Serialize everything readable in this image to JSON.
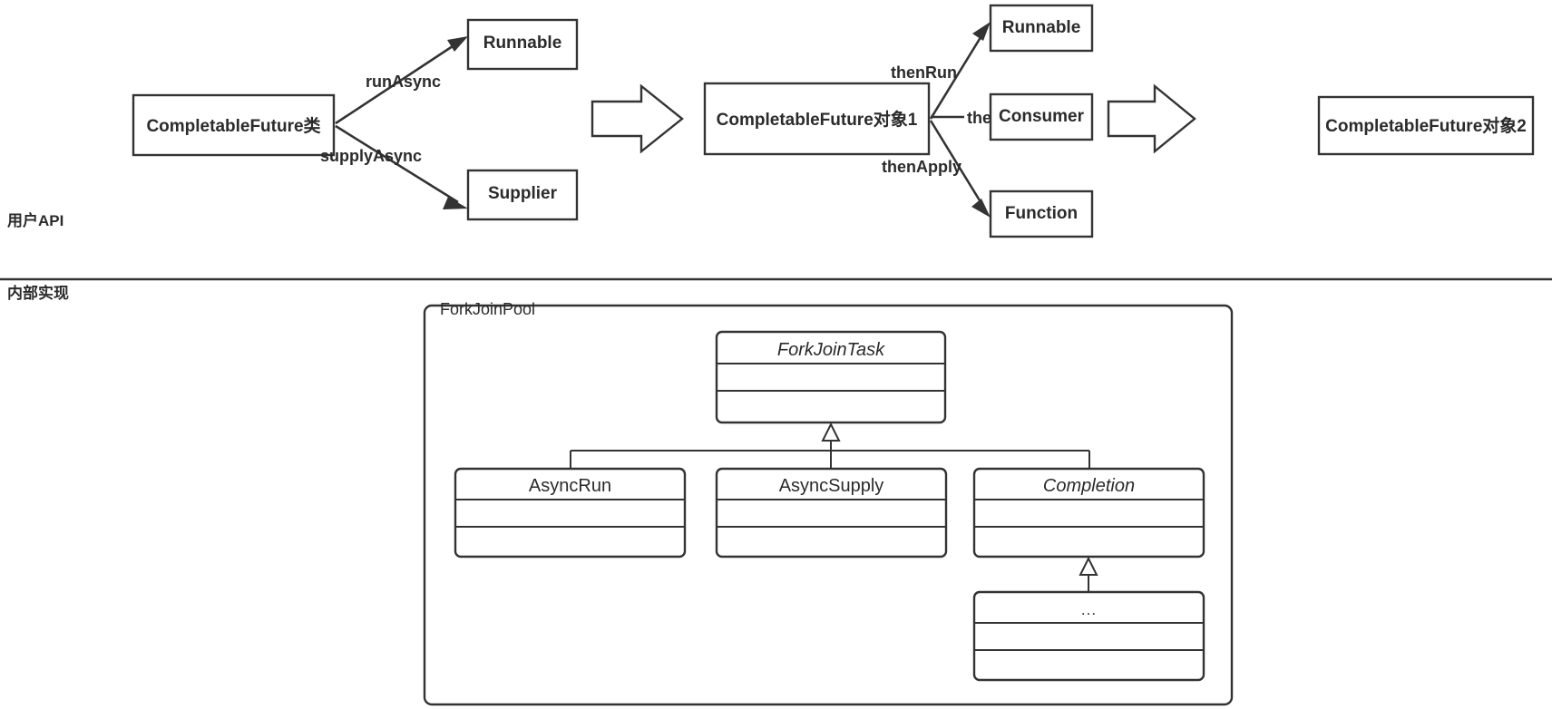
{
  "sections": {
    "upper_label": "用户API",
    "lower_label": "内部实现"
  },
  "api_flow": {
    "source_box": "CompletableFuture类",
    "factory_targets": [
      {
        "edge": "runAsync",
        "target": "Runnable"
      },
      {
        "edge": "supplyAsync",
        "target": "Supplier"
      }
    ],
    "future_one": "CompletableFuture对象1",
    "chain_targets": [
      {
        "edge": "thenRun",
        "target": "Runnable"
      },
      {
        "edge": "thenAccept",
        "target": "Consumer"
      },
      {
        "edge": "thenApply",
        "target": "Function"
      }
    ],
    "future_two": "CompletableFuture对象2",
    "block_arrow_icon": "block-right-arrow-icon"
  },
  "internal": {
    "pool_title": "ForkJoinPool",
    "classes": {
      "root": {
        "name": "ForkJoinTask",
        "abstract": true,
        "rows": 2
      },
      "children": [
        {
          "name": "AsyncRun",
          "abstract": false,
          "rows": 2
        },
        {
          "name": "AsyncSupply",
          "abstract": false,
          "rows": 2
        },
        {
          "name": "Completion",
          "abstract": true,
          "rows": 2
        }
      ],
      "leaf": {
        "name": "...",
        "abstract": false,
        "rows": 2
      }
    },
    "inheritance_arrow_icon": "hollow-triangle-inheritance-icon"
  },
  "colors": {
    "stroke": "#333333",
    "background": "#ffffff",
    "text": "#2b2b2b"
  }
}
